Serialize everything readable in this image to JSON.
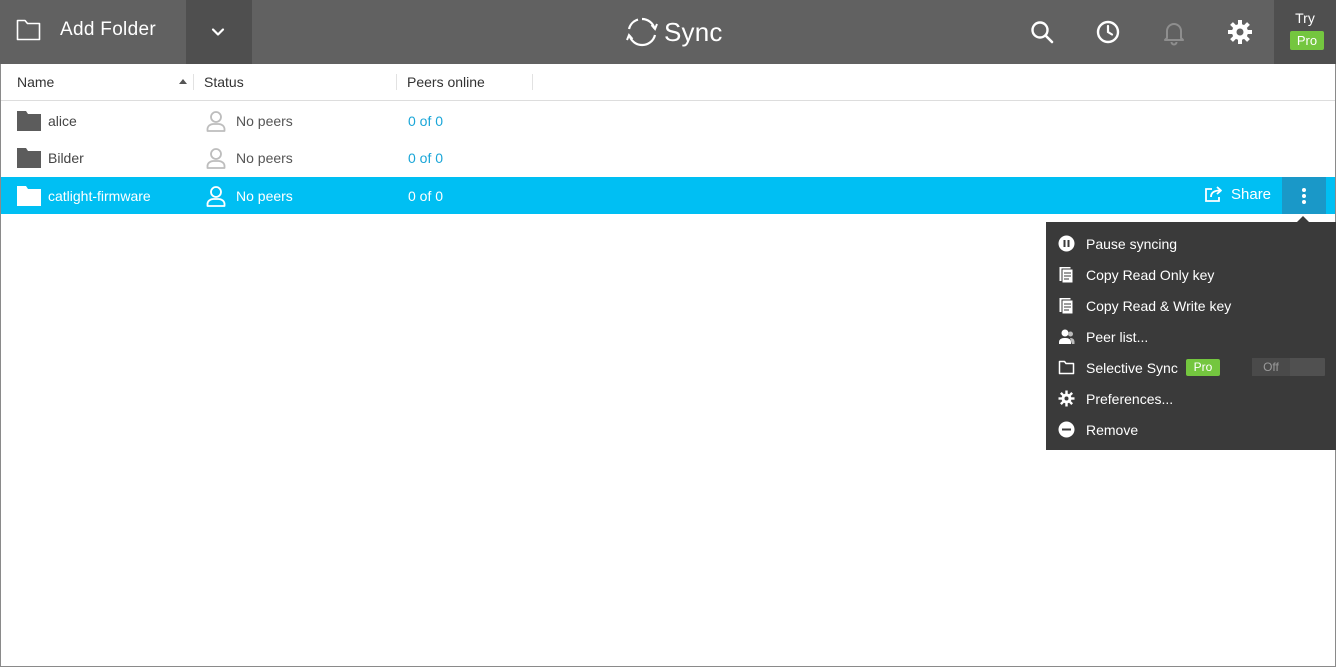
{
  "toolbar": {
    "add_folder_label": "Add Folder",
    "app_name": "Sync",
    "try_label": "Try",
    "pro_label": "Pro"
  },
  "icons": {
    "add_folder": "folder-outline-icon",
    "dropdown": "chevron-down-icon",
    "search": "search-icon",
    "history": "clock-icon",
    "notifications": "bell-icon",
    "settings": "gear-icon",
    "logo": "sync-logo-icon"
  },
  "table": {
    "columns": [
      {
        "label": "Name",
        "sorted": "ascending"
      },
      {
        "label": "Status"
      },
      {
        "label": "Peers online"
      }
    ],
    "rows": [
      {
        "name": "alice",
        "status": "No peers",
        "peers": "0 of 0",
        "selected": false
      },
      {
        "name": "Bilder",
        "status": "No peers",
        "peers": "0 of 0",
        "selected": false
      },
      {
        "name": "catlight-firmware",
        "status": "No peers",
        "peers": "0 of 0",
        "selected": true
      }
    ],
    "share_label": "Share"
  },
  "context_menu": {
    "items": [
      {
        "label": "Pause syncing",
        "icon": "pause-icon"
      },
      {
        "label": "Copy Read Only key",
        "icon": "copy-icon"
      },
      {
        "label": "Copy Read & Write key",
        "icon": "copy-icon"
      },
      {
        "label": "Peer list...",
        "icon": "peers-icon"
      },
      {
        "label": "Selective Sync",
        "icon": "folder-icon",
        "badge": "Pro",
        "toggle": "Off"
      },
      {
        "label": "Preferences...",
        "icon": "gear-icon"
      },
      {
        "label": "Remove",
        "icon": "remove-icon"
      }
    ]
  },
  "colors": {
    "topbar": "#616161",
    "topbar_dark": "#4f4f4f",
    "selection": "#00bff3",
    "link": "#1aa6d8",
    "pro_badge": "#74c63f",
    "menu_bg": "#3a3a3a"
  }
}
